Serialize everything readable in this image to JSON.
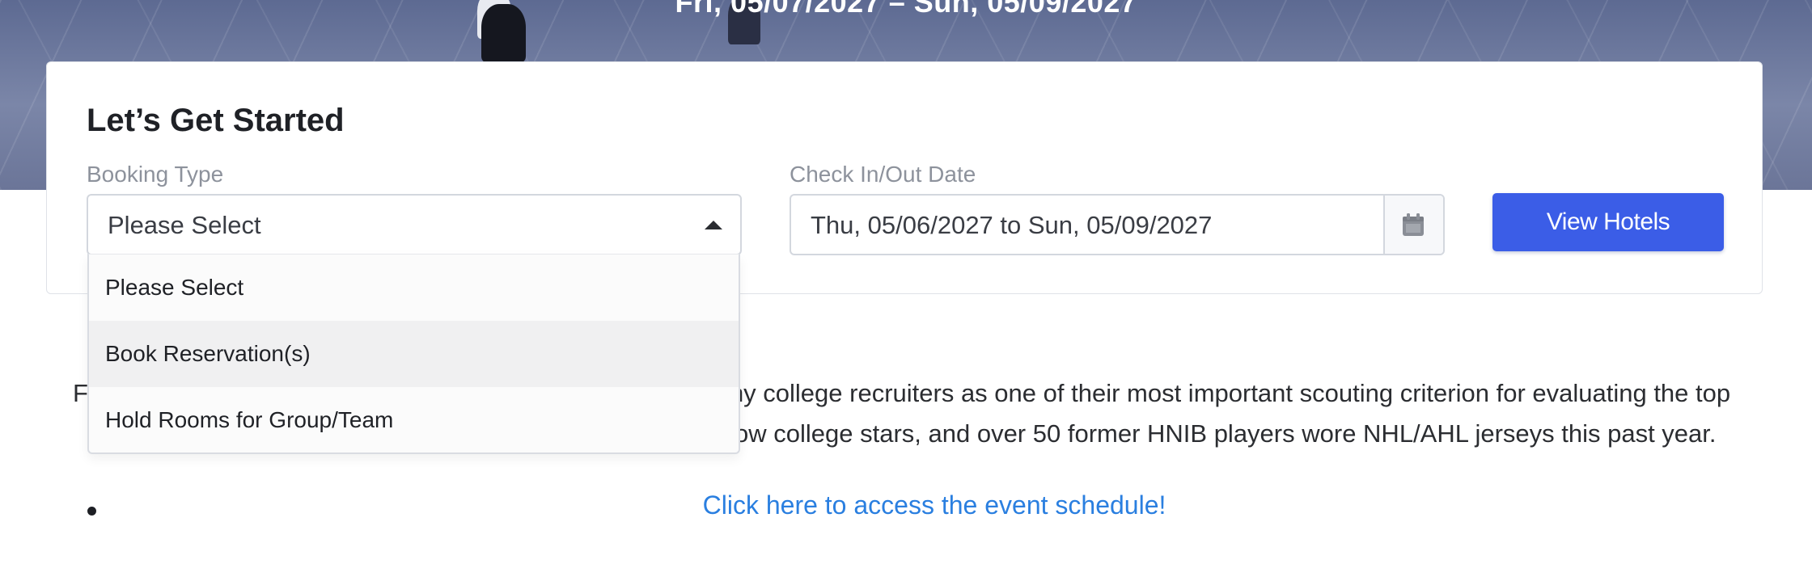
{
  "hero": {
    "dates": "Fri, 05/07/2027 – Sun, 05/09/2027"
  },
  "booking_form": {
    "title": "Let’s Get Started",
    "booking_type_label": "Booking Type",
    "booking_type_value": "Please Select",
    "date_label": "Check In/Out Date",
    "date_value": "Thu, 05/06/2027 to Sun, 05/09/2027",
    "calendar_icon": "calendar-icon",
    "submit_label": "View Hotels",
    "accent_color": "#3b5de7"
  },
  "dropdown": {
    "open": true,
    "hovered_option": "Book Reservation(s)",
    "options": [
      "Please Select",
      "Book Reservation(s)",
      "Hold Rooms for Group/Team"
    ]
  },
  "content": {
    "intro_line1_start": "F",
    "intro_line1_end": "ny college recruiters as one of their most important scouting criterion for evaluating the top",
    "intro_line2_end": "ow college stars, and over 50 former HNIB players wore NHL/AHL jerseys this past year.",
    "schedule_link": "Click here to access the event schedule!",
    "link_color": "#2a7fe0"
  }
}
